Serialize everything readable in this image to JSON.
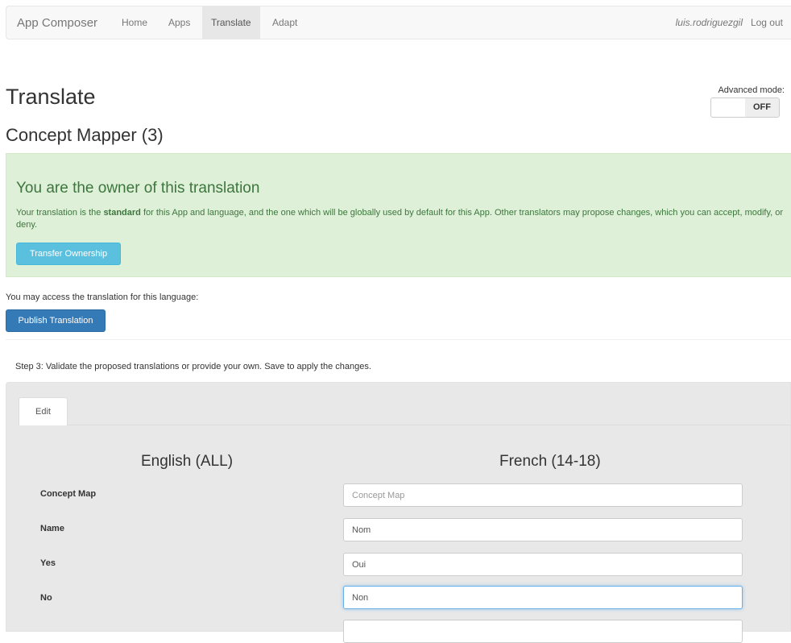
{
  "nav": {
    "brand": "App Composer",
    "links": [
      "Home",
      "Apps",
      "Translate",
      "Adapt"
    ],
    "active": "Translate",
    "user": "luis.rodriguezgil",
    "logout": "Log out"
  },
  "page": {
    "title": "Translate",
    "subtitle": "Concept Mapper (3)",
    "advanced_mode_label": "Advanced mode:",
    "advanced_mode_state": "OFF"
  },
  "alert": {
    "title": "You are the owner of this translation",
    "text_before": "Your translation is the ",
    "text_bold": "standard",
    "text_after": " for this App and language, and the one which will be globally used by default for this App. Other translators may propose changes, which you can accept, modify, or deny.",
    "button": "Transfer Ownership"
  },
  "access": {
    "text": "You may access the translation for this language:",
    "button": "Publish Translation"
  },
  "step_text": "Step 3: Validate the proposed translations or provide your own. Save to apply the changes.",
  "editor": {
    "tab": "Edit",
    "source_header": "English (ALL)",
    "target_header": "French (14-18)",
    "rows": [
      {
        "label": "Concept Map",
        "value": "",
        "placeholder": "Concept Map"
      },
      {
        "label": "Name",
        "value": "Nom",
        "placeholder": ""
      },
      {
        "label": "Yes",
        "value": "Oui",
        "placeholder": ""
      },
      {
        "label": "No",
        "value": "Non",
        "placeholder": ""
      },
      {
        "label": "",
        "value": "",
        "placeholder": ""
      }
    ]
  },
  "colors": {
    "alert_bg": "#dff0d8",
    "alert_text": "#3c763d",
    "btn_info": "#5bc0de",
    "btn_primary": "#337ab7"
  }
}
